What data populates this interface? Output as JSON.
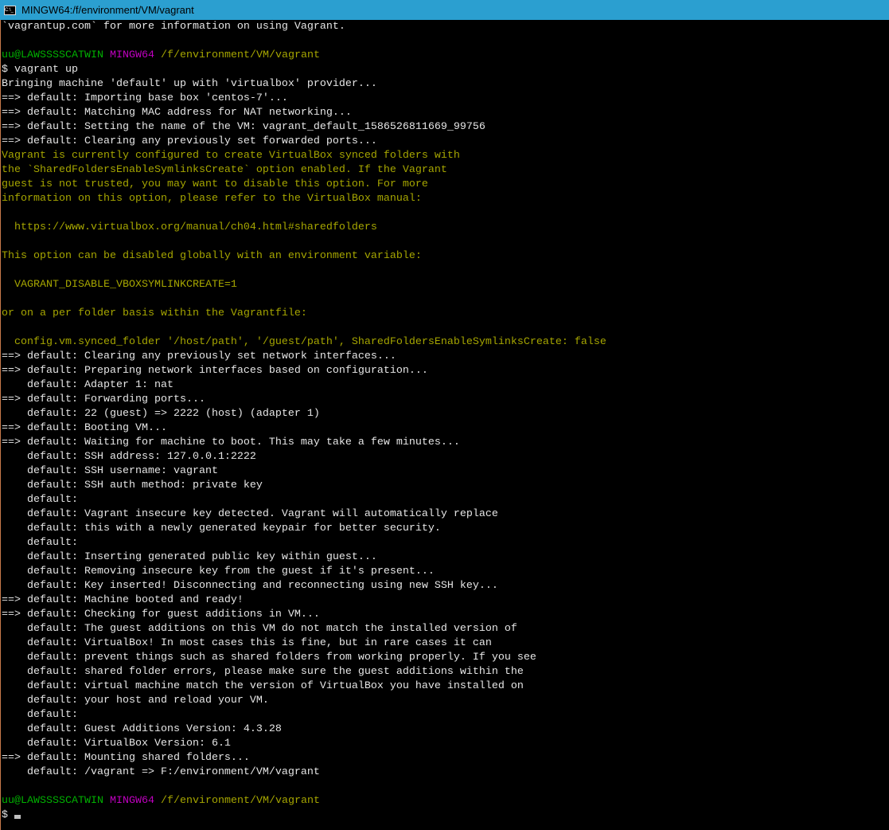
{
  "window": {
    "title": "MINGW64:/f/environment/VM/vagrant",
    "icon": "C:\\_"
  },
  "prompt": {
    "user": "uu@LAWSSSSCATWIN",
    "env": "MINGW64",
    "path": "/f/environment/VM/vagrant"
  },
  "colors": {
    "text": "#e6e6e6",
    "yellow": "#a6a600",
    "green": "#00b000",
    "magenta": "#c000c0",
    "titlebar": "#2b9fd0"
  },
  "lines": [
    {
      "c": "w",
      "t": "`vagrantup.com` for more information on using Vagrant."
    },
    {
      "c": "w",
      "t": ""
    },
    {
      "prompt": true
    },
    {
      "c": "w",
      "t": "$ vagrant up"
    },
    {
      "c": "w",
      "t": "Bringing machine 'default' up with 'virtualbox' provider..."
    },
    {
      "c": "w",
      "t": "==> default: Importing base box 'centos-7'..."
    },
    {
      "c": "w",
      "t": "==> default: Matching MAC address for NAT networking..."
    },
    {
      "c": "w",
      "t": "==> default: Setting the name of the VM: vagrant_default_1586526811669_99756"
    },
    {
      "c": "w",
      "t": "==> default: Clearing any previously set forwarded ports..."
    },
    {
      "c": "y",
      "t": "Vagrant is currently configured to create VirtualBox synced folders with"
    },
    {
      "c": "y",
      "t": "the `SharedFoldersEnableSymlinksCreate` option enabled. If the Vagrant"
    },
    {
      "c": "y",
      "t": "guest is not trusted, you may want to disable this option. For more"
    },
    {
      "c": "y",
      "t": "information on this option, please refer to the VirtualBox manual:"
    },
    {
      "c": "y",
      "t": ""
    },
    {
      "c": "y",
      "t": "  https://www.virtualbox.org/manual/ch04.html#sharedfolders"
    },
    {
      "c": "y",
      "t": ""
    },
    {
      "c": "y",
      "t": "This option can be disabled globally with an environment variable:"
    },
    {
      "c": "y",
      "t": ""
    },
    {
      "c": "y",
      "t": "  VAGRANT_DISABLE_VBOXSYMLINKCREATE=1"
    },
    {
      "c": "y",
      "t": ""
    },
    {
      "c": "y",
      "t": "or on a per folder basis within the Vagrantfile:"
    },
    {
      "c": "y",
      "t": ""
    },
    {
      "c": "y",
      "t": "  config.vm.synced_folder '/host/path', '/guest/path', SharedFoldersEnableSymlinksCreate: false"
    },
    {
      "c": "w",
      "t": "==> default: Clearing any previously set network interfaces..."
    },
    {
      "c": "w",
      "t": "==> default: Preparing network interfaces based on configuration..."
    },
    {
      "c": "w",
      "t": "    default: Adapter 1: nat"
    },
    {
      "c": "w",
      "t": "==> default: Forwarding ports..."
    },
    {
      "c": "w",
      "t": "    default: 22 (guest) => 2222 (host) (adapter 1)"
    },
    {
      "c": "w",
      "t": "==> default: Booting VM..."
    },
    {
      "c": "w",
      "t": "==> default: Waiting for machine to boot. This may take a few minutes..."
    },
    {
      "c": "w",
      "t": "    default: SSH address: 127.0.0.1:2222"
    },
    {
      "c": "w",
      "t": "    default: SSH username: vagrant"
    },
    {
      "c": "w",
      "t": "    default: SSH auth method: private key"
    },
    {
      "c": "w",
      "t": "    default:"
    },
    {
      "c": "w",
      "t": "    default: Vagrant insecure key detected. Vagrant will automatically replace"
    },
    {
      "c": "w",
      "t": "    default: this with a newly generated keypair for better security."
    },
    {
      "c": "w",
      "t": "    default:"
    },
    {
      "c": "w",
      "t": "    default: Inserting generated public key within guest..."
    },
    {
      "c": "w",
      "t": "    default: Removing insecure key from the guest if it's present..."
    },
    {
      "c": "w",
      "t": "    default: Key inserted! Disconnecting and reconnecting using new SSH key..."
    },
    {
      "c": "w",
      "t": "==> default: Machine booted and ready!"
    },
    {
      "c": "w",
      "t": "==> default: Checking for guest additions in VM..."
    },
    {
      "c": "w",
      "t": "    default: The guest additions on this VM do not match the installed version of"
    },
    {
      "c": "w",
      "t": "    default: VirtualBox! In most cases this is fine, but in rare cases it can"
    },
    {
      "c": "w",
      "t": "    default: prevent things such as shared folders from working properly. If you see"
    },
    {
      "c": "w",
      "t": "    default: shared folder errors, please make sure the guest additions within the"
    },
    {
      "c": "w",
      "t": "    default: virtual machine match the version of VirtualBox you have installed on"
    },
    {
      "c": "w",
      "t": "    default: your host and reload your VM."
    },
    {
      "c": "w",
      "t": "    default:"
    },
    {
      "c": "w",
      "t": "    default: Guest Additions Version: 4.3.28"
    },
    {
      "c": "w",
      "t": "    default: VirtualBox Version: 6.1"
    },
    {
      "c": "w",
      "t": "==> default: Mounting shared folders..."
    },
    {
      "c": "w",
      "t": "    default: /vagrant => F:/environment/VM/vagrant"
    },
    {
      "c": "w",
      "t": ""
    },
    {
      "prompt": true
    },
    {
      "c": "w",
      "t": "$ ",
      "cursor": true
    }
  ]
}
